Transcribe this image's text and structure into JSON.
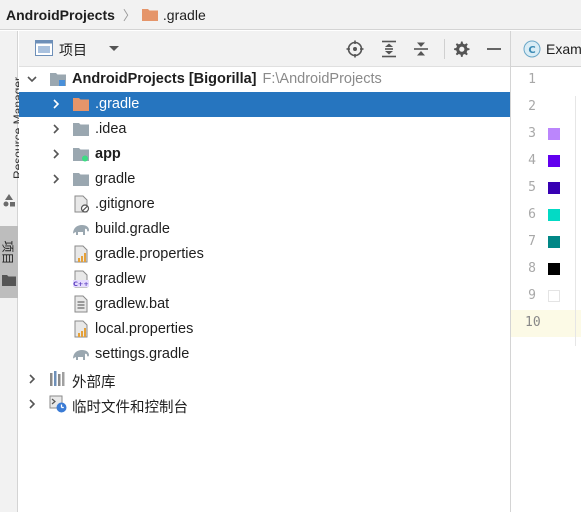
{
  "breadcrumb": {
    "root": "AndroidProjects",
    "current": ".gradle"
  },
  "left_strip": {
    "resource_manager": "Resource Manager",
    "project_tab": "项目"
  },
  "toolbar": {
    "view_label": "项目"
  },
  "tree": {
    "root": {
      "name": "AndroidProjects",
      "module": "[Bigorilla]",
      "path": "F:\\AndroidProjects"
    },
    "items": [
      {
        "label": ".gradle",
        "icon": "folder-orange",
        "expandable": true,
        "selected": true
      },
      {
        "label": ".idea",
        "icon": "folder",
        "expandable": true
      },
      {
        "label": "app",
        "icon": "module-folder",
        "expandable": true,
        "bold": true
      },
      {
        "label": "gradle",
        "icon": "folder",
        "expandable": true
      },
      {
        "label": ".gitignore",
        "icon": "file-ignored"
      },
      {
        "label": "build.gradle",
        "icon": "gradle-elephant"
      },
      {
        "label": "gradle.properties",
        "icon": "properties-file"
      },
      {
        "label": "gradlew",
        "icon": "cpp-file"
      },
      {
        "label": "gradlew.bat",
        "icon": "text-file"
      },
      {
        "label": "local.properties",
        "icon": "properties-file"
      },
      {
        "label": "settings.gradle",
        "icon": "gradle-elephant"
      }
    ],
    "external_libraries": "外部库",
    "scratches": "临时文件和控制台"
  },
  "editor": {
    "tab_label": "Exam",
    "lines": [
      {
        "num": "1",
        "swatch": null
      },
      {
        "num": "2",
        "swatch": null
      },
      {
        "num": "3",
        "swatch": "#bb86fc"
      },
      {
        "num": "4",
        "swatch": "#6200ee"
      },
      {
        "num": "5",
        "swatch": "#3700b3"
      },
      {
        "num": "6",
        "swatch": "#03dac5"
      },
      {
        "num": "7",
        "swatch": "#018786"
      },
      {
        "num": "8",
        "swatch": "#000000"
      },
      {
        "num": "9",
        "swatch": "#ffffff"
      },
      {
        "num": "10",
        "swatch": null
      }
    ]
  },
  "colors": {
    "selection": "#2675bf",
    "folder_orange": "#e5956a",
    "folder_grey": "#9aa7b0",
    "current_line": "#fcfae6"
  }
}
